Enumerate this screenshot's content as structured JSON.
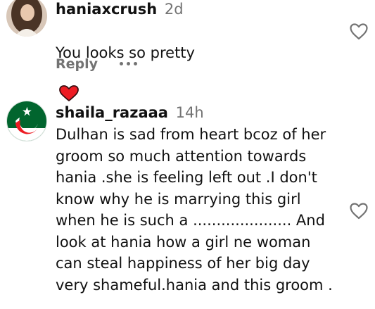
{
  "comments": [
    {
      "username": "haniaxcrush",
      "time": "2d",
      "text": "You looks so pretty",
      "emoji": "red-heart",
      "reply_label": "Reply"
    },
    {
      "username": "shaila_razaaa",
      "time": "14h",
      "text": "Dulhan is sad from heart bcoz of her\ngroom so much attention towards\nhania .she is feeling left out .I don't\nknow why he is marrying this girl\nwhen he is such a ..................... And\nlook at hania how a girl ne woman\ncan steal happiness of her big day\nvery shameful.hania and this groom ."
    }
  ],
  "colors": {
    "text": "#111111",
    "secondary": "#737373",
    "heart": "#ed1c24",
    "flag_green": "#01652e"
  }
}
